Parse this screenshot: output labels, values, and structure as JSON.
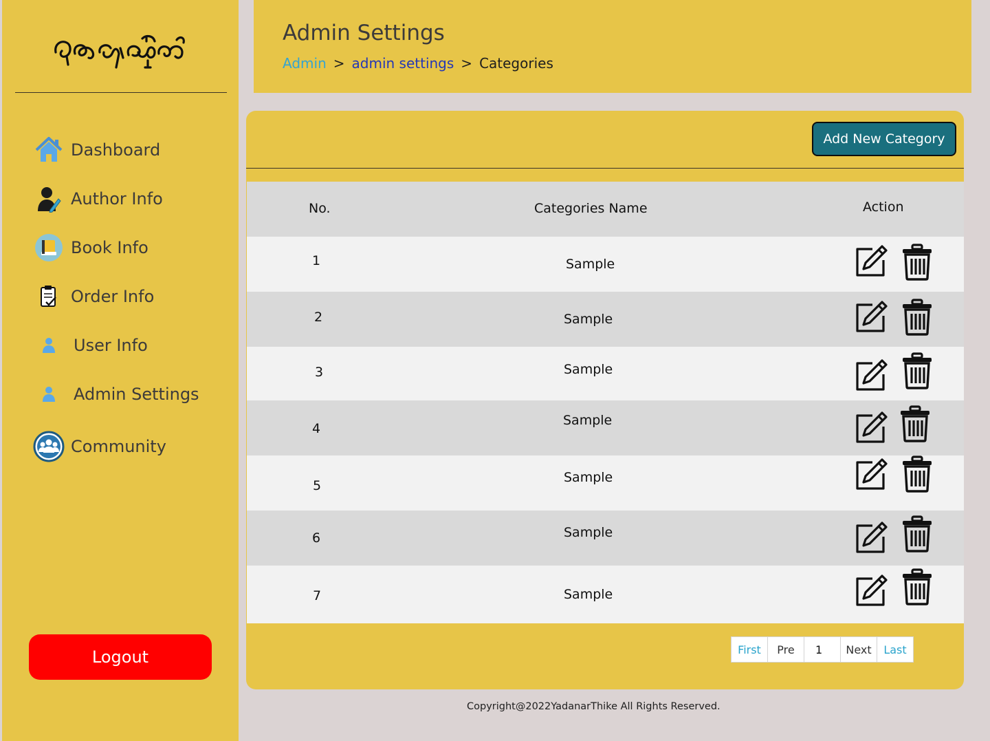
{
  "brand": {
    "logo_text": "ရတနာသိုက်"
  },
  "sidebar": {
    "items": [
      {
        "label": "Dashboard",
        "icon": "home-icon"
      },
      {
        "label": "Author Info",
        "icon": "author-icon"
      },
      {
        "label": "Book Info",
        "icon": "book-icon"
      },
      {
        "label": "Order Info",
        "icon": "clipboard-icon"
      },
      {
        "label": "User Info",
        "icon": "user-icon"
      },
      {
        "label": "Admin Settings",
        "icon": "user-icon"
      },
      {
        "label": "Community",
        "icon": "community-icon"
      }
    ],
    "logout_label": "Logout"
  },
  "header": {
    "title": "Admin Settings",
    "breadcrumb": {
      "root": "Admin",
      "separator": ">",
      "parent": "admin settings",
      "current": "Categories"
    }
  },
  "panel": {
    "add_button_label": "Add New Category"
  },
  "table": {
    "columns": [
      "No.",
      "Categories Name",
      "Action"
    ],
    "rows": [
      {
        "no": "1",
        "name": "Sample"
      },
      {
        "no": "2",
        "name": "Sample"
      },
      {
        "no": "3",
        "name": "Sample"
      },
      {
        "no": "4",
        "name": "Sample"
      },
      {
        "no": "5",
        "name": "Sample"
      },
      {
        "no": "6",
        "name": "Sample"
      },
      {
        "no": "7",
        "name": "Sample"
      }
    ],
    "action_icons": [
      "edit-icon",
      "trash-icon"
    ]
  },
  "pagination": {
    "first": "First",
    "prev": "Pre",
    "current": "1",
    "next": "Next",
    "last": "Last"
  },
  "footer": {
    "copyright": "Copyright@2022YadanarThike All Rights Reserved."
  },
  "colors": {
    "page_bg": "#dbd3d3",
    "panel_yellow": "#e7c548",
    "button_teal": "#1a6f7e",
    "logout_red": "#ff0000",
    "link_light_blue": "#36a4d0",
    "link_dark_blue": "#2437b6"
  }
}
